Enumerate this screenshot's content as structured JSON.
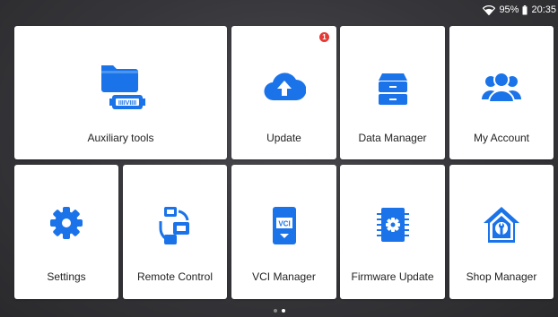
{
  "status": {
    "wifi_icon": "wifi-icon",
    "battery_percent": "95%",
    "battery_icon": "battery-icon",
    "time": "20:35"
  },
  "tiles": [
    {
      "label": "Auxiliary tools",
      "icon": "folder-connector-icon"
    },
    {
      "label": "Update",
      "icon": "cloud-upload-icon",
      "badge": "1"
    },
    {
      "label": "Data Manager",
      "icon": "filing-cabinet-icon"
    },
    {
      "label": "My Account",
      "icon": "users-icon"
    },
    {
      "label": "Settings",
      "icon": "gear-icon"
    },
    {
      "label": "Remote Control",
      "icon": "remote-sync-icon"
    },
    {
      "label": "VCI Manager",
      "icon": "vci-icon"
    },
    {
      "label": "Firmware Update",
      "icon": "chip-gear-icon"
    },
    {
      "label": "Shop Manager",
      "icon": "house-wrench-icon"
    }
  ],
  "pager": {
    "pages": 2,
    "current": 2
  },
  "colors": {
    "accent": "#1a73e8",
    "badge": "#e53935",
    "tile": "#ffffff"
  }
}
